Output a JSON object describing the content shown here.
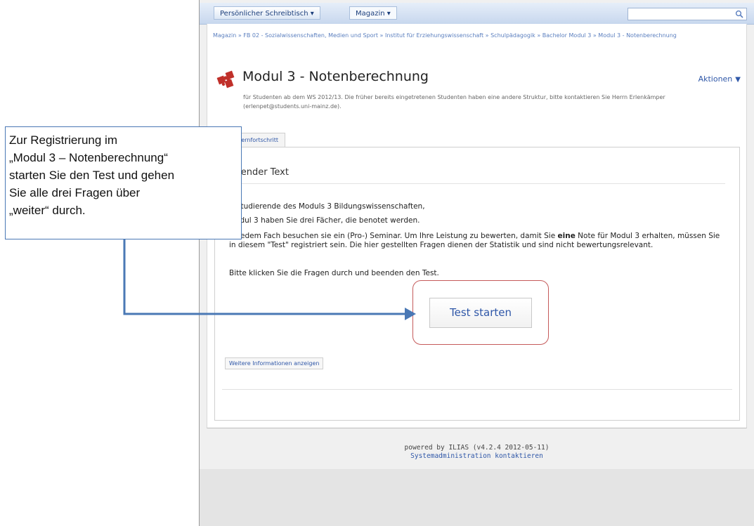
{
  "topbar": {
    "menu_desktop": "Persönlicher Schreibtisch ▾",
    "menu_magazin": "Magazin ▾",
    "search_placeholder": ""
  },
  "breadcrumb": {
    "text": "Magazin » FB 02 - Sozialwissenschaften, Medien und Sport » Institut für Erziehungswissenschaft » Schulpädagogik » Bachelor Modul 3 » Modul 3 - Notenberechnung"
  },
  "header": {
    "title": "Modul 3 - Notenberechnung",
    "actions_label": "Aktionen",
    "description": "für Studenten ab dem WS 2012/13. Die früher bereits eingetretenen Studenten haben eine andere Struktur, bitte kontaktieren Sie Herrn Erlenkämper (erlenpet@students.uni-mainz.de)."
  },
  "tabs": [
    {
      "label": "Lernfortschritt"
    }
  ],
  "content": {
    "heading": "eitender Text",
    "p1": "e Studierende des Moduls 3 Bildungswissenschaften,",
    "p2": "Modul 3 haben Sie drei Fächer, die benotet werden.",
    "p3_before": "In jedem Fach besuchen sie ein (Pro-) Seminar. Um Ihre Leistung zu bewerten, damit Sie ",
    "p3_bold": "eine",
    "p3_after": " Note für Modul 3 erhalten, müssen Sie in diesem \"Test\" registriert sein. Die hier gestellten Fragen dienen der Statistik und sind nicht bewertungsrelevant.",
    "p4": "Bitte klicken Sie die Fragen durch und beenden den Test.",
    "start_button": "Test starten",
    "more_info_button": "Weitere Informationen anzeigen"
  },
  "footer": {
    "powered": "powered by ILIAS (v4.2.4 2012-05-11)",
    "admin_link": "Systemadministration kontaktieren"
  },
  "callout": {
    "lines": [
      "Zur Registrierung im",
      "„Modul 3 – Notenberechnung“",
      "starten Sie den Test und gehen",
      "Sie alle drei Fragen über",
      "„weiter“ durch."
    ]
  },
  "colors": {
    "link": "#2f57a8",
    "callout_border": "#4a78b5",
    "highlight_ring": "#c55a5a",
    "icon_red": "#c0302a"
  },
  "icons": {
    "title_icon": "puzzle-icon",
    "search": "search-icon",
    "actions_caret": "caret-down-icon"
  }
}
